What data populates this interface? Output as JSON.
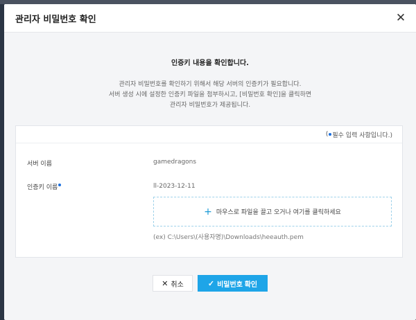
{
  "modal": {
    "title": "관리자 비밀번호 확인",
    "close_icon": "close-icon"
  },
  "intro": {
    "heading": "인증키 내용을 확인합니다.",
    "lines": [
      "관리자 비밀번호를 확인하기 위해서 해당 서버의 인증키가 필요합니다.",
      "서버 생성 시에 설정한 인증키 파일을 첨부하시고, [비밀번호 확인]을 클릭하면",
      "관리자 비밀번호가 제공됩니다."
    ]
  },
  "form": {
    "required_note_open": "(",
    "required_note_text": "필수 입력 사항입니다.)",
    "server_name_label": "서버 이름",
    "server_name_value": "gamedragons",
    "auth_key_label": "인증키 이름",
    "auth_key_value": "ll-2023-12-11",
    "dropzone_text": "마우스로 파일을 끌고 오거나 여기를 클릭하세요",
    "example_path": "(ex) C:\\Users\\(사용자명)\\Downloads\\heeauth.pem"
  },
  "footer": {
    "cancel_label": "취소",
    "confirm_label": "비밀번호 확인"
  },
  "colors": {
    "accent": "#1ea5e8",
    "required_dot": "#1a6fe0"
  }
}
